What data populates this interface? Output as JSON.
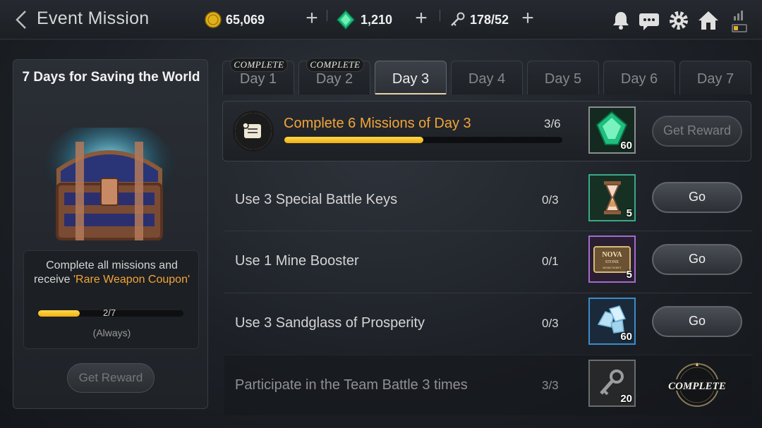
{
  "header": {
    "title": "Event Mission",
    "gold": "65,069",
    "gems": "1,210",
    "keys": "178/52"
  },
  "left_panel": {
    "title": "7 Days for Saving the World",
    "desc_line1": "Complete all missions and",
    "desc_prefix": "receive ",
    "desc_highlight": "'Rare Weapon Coupon'",
    "progress_text": "2/7",
    "progress": 0.2857,
    "note": "(Always)",
    "button": "Get Reward"
  },
  "tabs": [
    {
      "label": "Day 1",
      "badge": "COMPLETE"
    },
    {
      "label": "Day 2",
      "badge": "COMPLETE"
    },
    {
      "label": "Day 3",
      "badge": ""
    },
    {
      "label": "Day 4",
      "badge": ""
    },
    {
      "label": "Day 5",
      "badge": ""
    },
    {
      "label": "Day 6",
      "badge": ""
    },
    {
      "label": "Day 7",
      "badge": ""
    }
  ],
  "main_mission": {
    "title": "Complete 6 Missions of Day 3",
    "progress_text": "3/6",
    "progress": 0.5,
    "reward_count": "60",
    "button": "Get Reward"
  },
  "missions": [
    {
      "title": "Use 3 Special Battle Keys",
      "progress": "0/3",
      "reward_count": "5",
      "button": "Go"
    },
    {
      "title": "Use 1 Mine Booster",
      "progress": "0/1",
      "reward_count": "5",
      "button": "Go"
    },
    {
      "title": "Use 3 Sandglass of Prosperity",
      "progress": "0/3",
      "reward_count": "60",
      "button": "Go"
    },
    {
      "title": "Participate in the Team Battle 3 times",
      "progress": "3/3",
      "reward_count": "20",
      "stamp": "COMPLETE"
    }
  ],
  "reward_labels": {
    "nova_top": "NOVA",
    "nova_mid": "STONE",
    "nova_bottom": "NOVA TICKET"
  },
  "colors": {
    "accent": "#f2a53a",
    "progress_fill": "#f5c21c"
  }
}
